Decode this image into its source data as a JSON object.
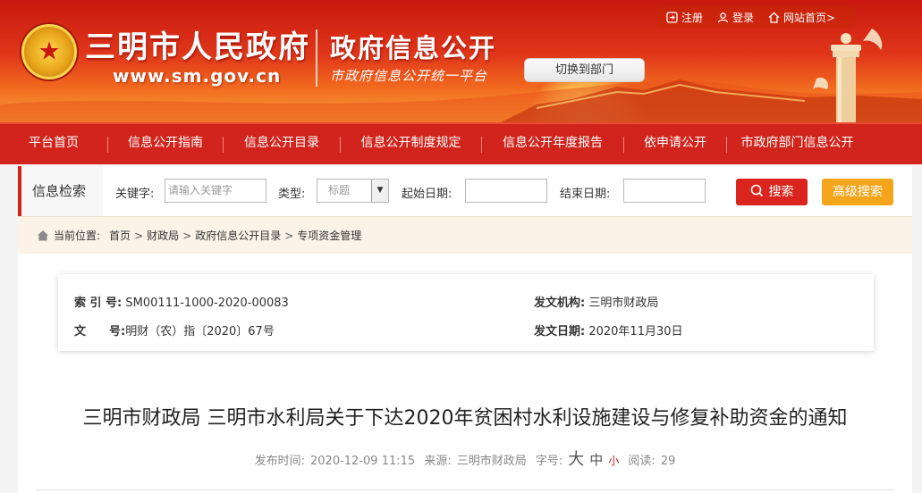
{
  "header": {
    "site_title": "三明市人民政府",
    "site_url": "www.sm.gov.cn",
    "section_title": "政府信息公开",
    "section_subtitle": "市政府信息公开统一平台",
    "switch_dept": "切换到部门",
    "top_links": {
      "register": "注册",
      "login": "登录",
      "home": "网站首页>"
    }
  },
  "nav": {
    "items": [
      "平台首页",
      "信息公开指南",
      "信息公开目录",
      "信息公开制度规定",
      "信息公开年度报告",
      "依申请公开",
      "市政府部门信息公开"
    ]
  },
  "search": {
    "section_label": "信息检索",
    "keyword_label": "关键字:",
    "keyword_placeholder": "请输入关键字",
    "type_label": "类型:",
    "type_selected": "标题",
    "start_label": "起始日期:",
    "end_label": "结束日期:",
    "search_button": "搜索",
    "advanced_button": "高级搜索"
  },
  "breadcrumb": {
    "label": "当前位置:",
    "items": [
      "首页",
      "财政局",
      "政府信息公开目录",
      "专项资金管理"
    ],
    "separator": ">"
  },
  "meta": {
    "index_label": "索 引 号:",
    "index_value": "SM00111-1000-2020-00083",
    "docno_label": "文　　号:",
    "docno_value": "明财（农）指〔2020〕67号",
    "issuer_label": "发文机构:",
    "issuer_value": "三明市财政局",
    "date_label": "发文日期:",
    "date_value": "2020年11月30日"
  },
  "article": {
    "title": "三明市财政局 三明市水利局关于下达2020年贫困村水利设施建设与修复补助资金的通知",
    "publish_label": "发布时间:",
    "publish_value": "2020-12-09 11:15",
    "source_label": "来源:",
    "source_value": "三明市财政局",
    "fontsize_label": "字号:",
    "fontsize_large": "大",
    "fontsize_medium": "中",
    "fontsize_small": "小",
    "views_label": "阅读:",
    "views_value": "29"
  },
  "colors": {
    "brand_red": "#d1241c",
    "advanced_orange": "#f4a51c",
    "breadcrumb_bg": "#fbf3e7"
  },
  "icons": [
    "emblem-icon",
    "register-icon",
    "user-icon",
    "home-icon",
    "search-icon",
    "breadcrumb-home-icon",
    "pillar-illustration"
  ]
}
